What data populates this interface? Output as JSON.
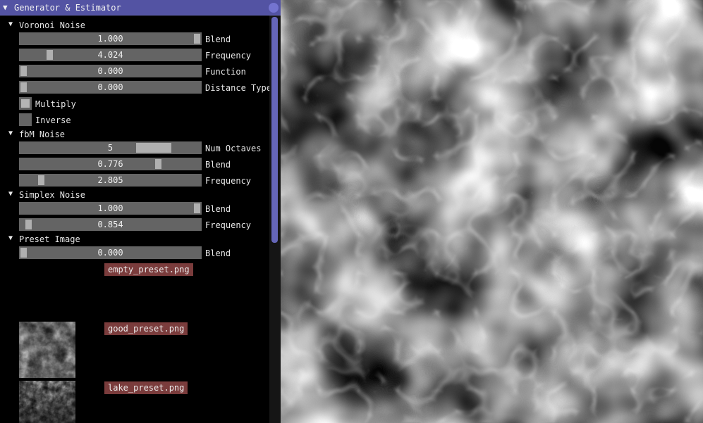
{
  "window": {
    "title": "Generator & Estimator"
  },
  "sections": {
    "voronoi": {
      "title": "Voronoi Noise",
      "sliders": [
        {
          "value": "1.000",
          "label": "Blend",
          "fraction": 1.0
        },
        {
          "value": "4.024",
          "label": "Frequency",
          "fraction": 0.15
        },
        {
          "value": "0.000",
          "label": "Function",
          "fraction": 0.0
        },
        {
          "value": "0.000",
          "label": "Distance Type",
          "fraction": 0.0
        }
      ],
      "checkboxes": [
        {
          "label": "Multiply",
          "checked": true
        },
        {
          "label": "Inverse",
          "checked": false
        }
      ]
    },
    "fbm": {
      "title": "fbM Noise",
      "sliders": [
        {
          "value": "5",
          "label": "Num Octaves",
          "fraction": 0.8
        },
        {
          "value": "0.776",
          "label": "Blend",
          "fraction": 0.776
        },
        {
          "value": "2.805",
          "label": "Frequency",
          "fraction": 0.1
        }
      ]
    },
    "simplex": {
      "title": "Simplex Noise",
      "sliders": [
        {
          "value": "1.000",
          "label": "Blend",
          "fraction": 1.0
        },
        {
          "value": "0.854",
          "label": "Frequency",
          "fraction": 0.03
        }
      ]
    },
    "preset": {
      "title": "Preset Image",
      "sliders": [
        {
          "value": "0.000",
          "label": "Blend",
          "fraction": 0.0
        }
      ],
      "files": [
        {
          "name": "empty_preset.png"
        },
        {
          "name": "good_preset.png"
        },
        {
          "name": "lake_preset.png"
        }
      ]
    }
  },
  "colors": {
    "title_bar": "#5353a3",
    "slider_bg": "#646464",
    "slider_grab": "#b0b0b0",
    "file_button": "#7a3c3c",
    "scroll_thumb": "#6566b8"
  }
}
